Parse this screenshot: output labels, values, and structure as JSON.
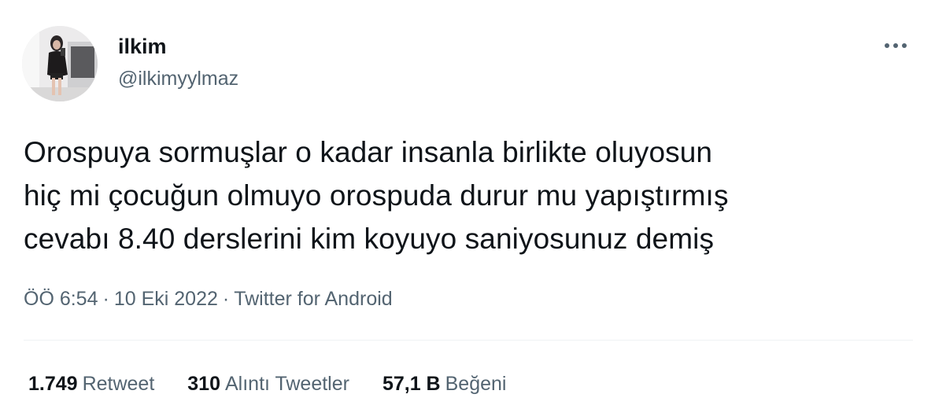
{
  "user": {
    "display_name": "ilkim",
    "handle": "@ilkimyylmaz",
    "avatar_icon": "profile-photo"
  },
  "tweet": {
    "text": "Orospuya sormuşlar o kadar insanla birlikte oluyosun\nhiç mi çocuğun olmuyo orospuda durur mu yapıştırmış\ncevabı 8.40 derslerini kim koyuyo saniyosunuz demiş",
    "time": "ÖÖ 6:54",
    "separator": "·",
    "date": "10 Eki 2022",
    "source": "Twitter for Android"
  },
  "stats": {
    "retweets_count": "1.749",
    "retweets_label": "Retweet",
    "quotes_count": "310",
    "quotes_label": "Alıntı Tweetler",
    "likes_count": "57,1 B",
    "likes_label": "Beğeni"
  },
  "icons": {
    "more": "more-horizontal-icon"
  },
  "colors": {
    "text_primary": "#0f1419",
    "text_secondary": "#536471",
    "divider": "#eff3f4"
  }
}
